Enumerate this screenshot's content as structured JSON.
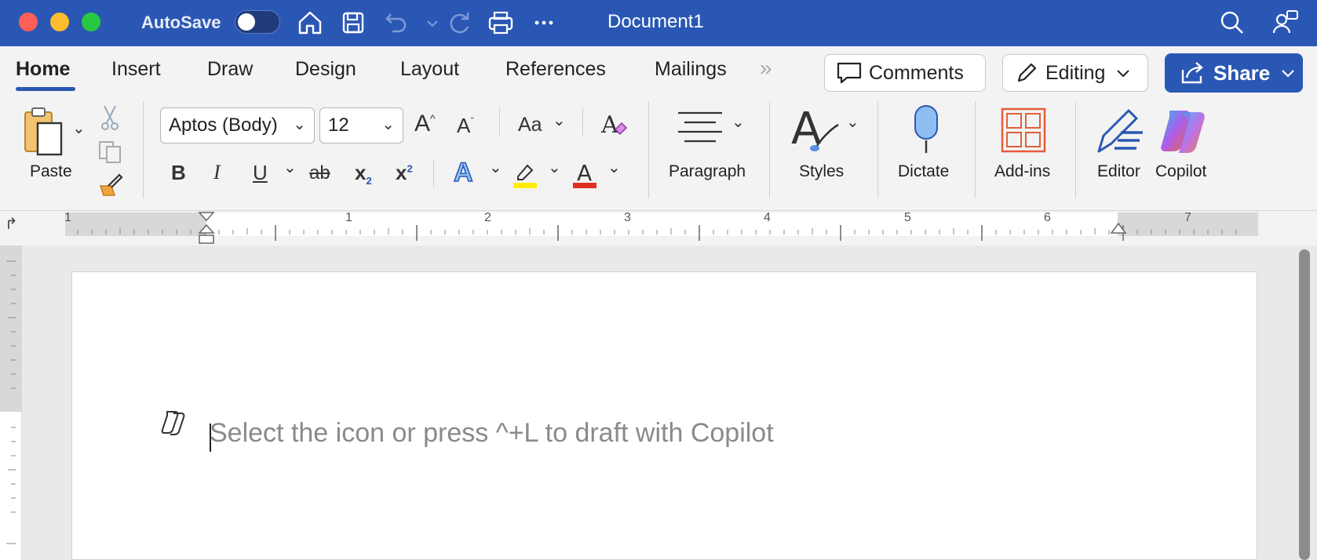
{
  "titlebar": {
    "autosave_label": "AutoSave",
    "document_title": "Document1"
  },
  "tabs": [
    {
      "label": "Home"
    },
    {
      "label": "Insert"
    },
    {
      "label": "Draw"
    },
    {
      "label": "Design"
    },
    {
      "label": "Layout"
    },
    {
      "label": "References"
    },
    {
      "label": "Mailings"
    }
  ],
  "actions": {
    "comments_label": "Comments",
    "editing_label": "Editing",
    "share_label": "Share"
  },
  "toolbar": {
    "paste_label": "Paste",
    "font_name": "Aptos (Body)",
    "font_size": "12",
    "change_case_label": "Aa",
    "paragraph_label": "Paragraph",
    "styles_label": "Styles",
    "dictate_label": "Dictate",
    "addins_label": "Add-ins",
    "editor_label": "Editor",
    "copilot_label": "Copilot"
  },
  "ruler": {
    "numbers": [
      "1",
      "1",
      "2",
      "3",
      "4",
      "5",
      "6",
      "7"
    ]
  },
  "document": {
    "placeholder": "Select the icon or press ^+L to draft with Copilot"
  },
  "colors": {
    "titlebar": "#2b57b4",
    "highlight": "#ffee00",
    "font_color": "#e03020"
  }
}
